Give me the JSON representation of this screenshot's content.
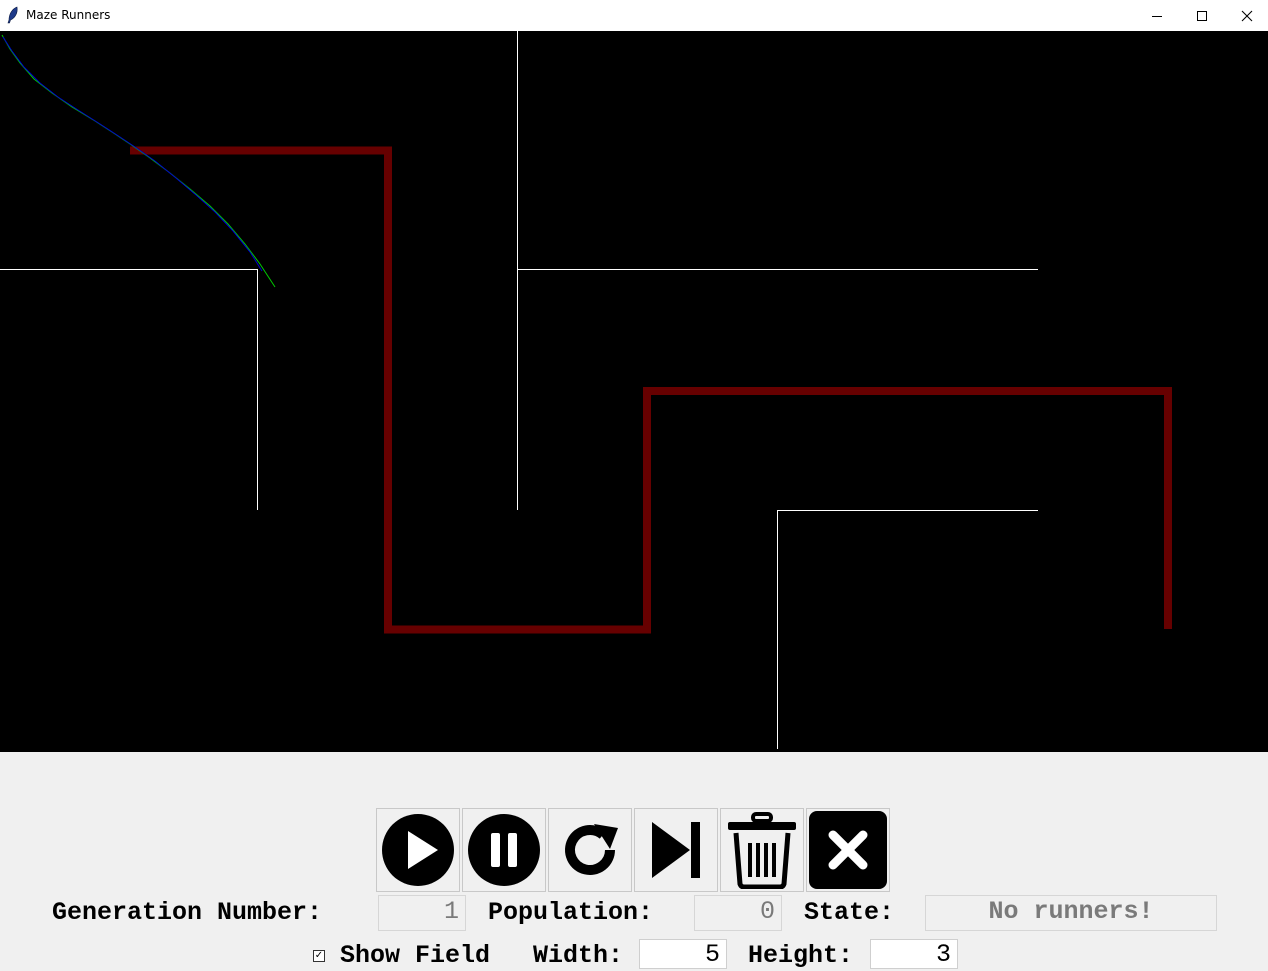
{
  "window": {
    "title": "Maze Runners"
  },
  "toolbar": {
    "buttons": [
      {
        "name": "play",
        "icon": "play-icon"
      },
      {
        "name": "pause",
        "icon": "pause-icon"
      },
      {
        "name": "restart",
        "icon": "restart-icon"
      },
      {
        "name": "step",
        "icon": "step-forward-icon"
      },
      {
        "name": "delete",
        "icon": "trash-icon"
      },
      {
        "name": "close",
        "icon": "close-icon"
      }
    ]
  },
  "stats": {
    "generation_label": "Generation Number:",
    "generation_value": "1",
    "population_label": "Population:",
    "population_value": "0",
    "state_label": "State:",
    "state_value": "No runners!"
  },
  "settings": {
    "show_field_label": "Show Field",
    "show_field_checked": true,
    "width_label": "Width:",
    "width_value": "5",
    "height_label": "Height:",
    "height_value": "3"
  },
  "colors": {
    "canvas_bg": "#000000",
    "maze_wall": "#ffffff",
    "path": "#660000",
    "runner_green": "#00cc00",
    "runner_blue": "#0000cc"
  }
}
